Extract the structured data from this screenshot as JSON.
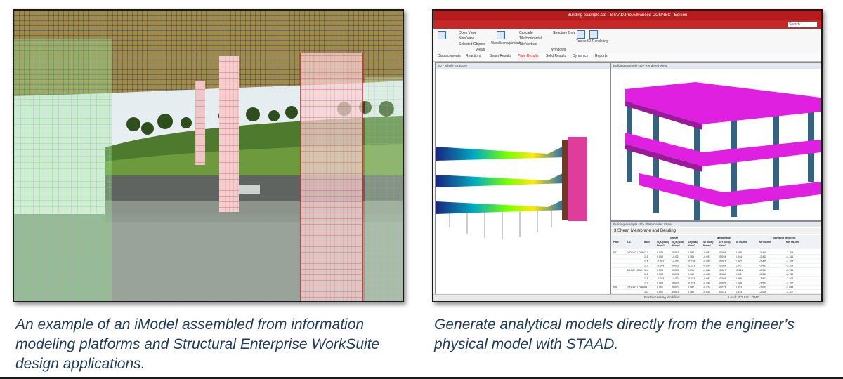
{
  "left_figure": {
    "caption_lines": [
      "An example of an iModel assembled from information",
      "modeling platforms and Structural Enterprise WorkSuite",
      "design applications."
    ]
  },
  "right_figure": {
    "caption_lines": [
      "Generate analytical models directly from the engineer’s",
      "physical model with STAAD."
    ],
    "app": {
      "window_title": "Building example.std - STAAD.Pro Advanced CONNECT Edition",
      "search_placeholder": "Search",
      "ribbon": {
        "buttons": [
          "Open View",
          "New View",
          "Selected Objects",
          "View Management",
          "Cascade",
          "Tile Horizontal",
          "Tile Vertical",
          "Structure Only",
          "Tables",
          "3D Rendering"
        ],
        "groups": [
          "Views",
          "Windows"
        ]
      },
      "tabs": [
        "Displacements",
        "Reactions",
        "Beam Results",
        "Plate Results",
        "Solid Results",
        "Dynamics",
        "Reports"
      ],
      "active_tab_index": 3,
      "left_pane_title": "3D - Whole Structure",
      "right_pane_title": "Building example.std - Rendered View",
      "table_pane_title": "Building example.std - Plate Center Stress",
      "table_tab": "3.Shear, Membrane and Bending",
      "table": {
        "group_headers": [
          "Shear",
          "Membrane",
          "Bending Moment"
        ],
        "columns": [
          "Plate",
          "L/C",
          "Node",
          "SQX (local) N/mm2",
          "SQY (local) N/mm2",
          "SX (local) N/mm2",
          "SY (local) N/mm2",
          "SXY (local) N/mm2",
          "Mx kN-m/m",
          "My kN-m/m",
          "Mxy kN-m/m"
        ],
        "rows": [
          [
            "507",
            "1 DEAD LOAD",
            "114",
            "0.003",
            "0.003",
            "0.097",
            "-0.082",
            "-0.088",
            "0.095",
            "-2.410",
            "-2.109"
          ],
          [
            "",
            "",
            "115",
            "0.003",
            "-0.003",
            "0.166",
            "-0.091",
            "-0.094",
            "1.514",
            "-2.412",
            "-2.141"
          ],
          [
            "",
            "",
            "116",
            "-0.001",
            "-0.002",
            "-0.078",
            "-0.099",
            "-0.087",
            "1.047",
            "-2.415",
            "-2.107"
          ],
          [
            "",
            "",
            "117",
            "-0.003",
            "0.003",
            "-0.021",
            "-0.090",
            "-0.089",
            "1.047",
            "-2.412",
            "-2.109"
          ],
          [
            "",
            "2 LIVE LOAD",
            "114",
            "0.003",
            "0.003",
            "0.090",
            "-0.082",
            "-0.087",
            "-0.084",
            "-2.519",
            "-2.101"
          ],
          [
            "",
            "",
            "115",
            "0.003",
            "0.003",
            "0.161",
            "-0.080",
            "-0.082",
            "1.611",
            "-2.516",
            "-2.130"
          ],
          [
            "",
            "",
            "116",
            "-0.003",
            "-0.002",
            "-0.023",
            "-0.087",
            "-0.085",
            "0.986",
            "-2.512",
            "-2.106"
          ],
          [
            "",
            "",
            "117",
            "0.003",
            "0.002",
            "-0.023",
            "-0.098",
            "-0.085",
            "1.096",
            "-2.519",
            "-2.102"
          ],
          [
            "508",
            "1 DEAD LOAD",
            "83",
            "0.001",
            "0.001",
            "0.087",
            "-0.074",
            "-0.013",
            "0.513",
            "-2.019",
            "-2.098"
          ],
          [
            "",
            "",
            "107",
            "0.002",
            "0.003",
            "0.160",
            "-0.035",
            "-0.021",
            "1.513",
            "-2.006",
            "-2.112"
          ]
        ]
      },
      "status": {
        "workflow": "Postprocessing Workflow",
        "load": "Load : 2 \"LIVE LOAD\""
      }
    }
  }
}
